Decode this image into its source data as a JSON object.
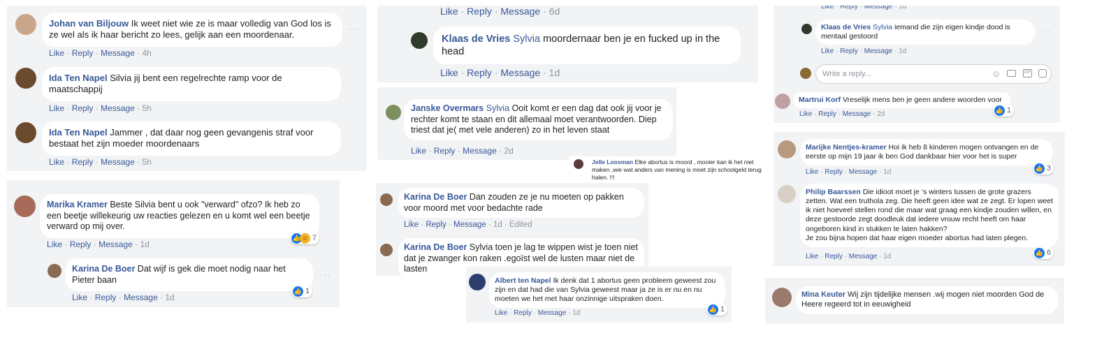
{
  "actions": {
    "like": "Like",
    "reply": "Reply",
    "message": "Message",
    "sep": "·",
    "edited": "Edited"
  },
  "p1": {
    "c1": {
      "name": "Johan van Biljouw",
      "text": "Ik weet niet wie ze is maar volledig van God los is ze wel als ik haar bericht zo lees, gelijk aan een moordenaar.",
      "time": "4h"
    },
    "c2": {
      "name": "Ida Ten Napel",
      "text": "Silvia jij bent een regelrechte ramp voor de maatschappij",
      "time": "5h"
    },
    "c3": {
      "name": "Ida Ten Napel",
      "text": "Jammer , dat daar nog geen gevangenis straf voor bestaat het zijn moeder moordenaars",
      "time": "5h"
    }
  },
  "p2": {
    "c1": {
      "name": "Marika Kramer",
      "text": "Beste Silvia bent u ook \"verward\" ofzo? Ik heb zo een beetje willekeurig uw reacties gelezen en u komt wel een beetje verward op mij over.",
      "time": "1d",
      "reactions": "7"
    },
    "c2": {
      "name": "Karina De Boer",
      "text": "Dat wijf is gek die moet nodig naar het Pieter baan",
      "time": "1d",
      "reactions": "1"
    }
  },
  "p3": {
    "top_time": "6d",
    "c1": {
      "name": "Klaas de Vries",
      "mention": "Sylvia",
      "text": "moordernaar ben je en fucked up in the head",
      "time": "1d"
    }
  },
  "p4": {
    "c1": {
      "name": "Janske Overmars",
      "mention": "Sylvia",
      "text": "Ooit komt er een dag dat ook jij voor je rechter komt te staan en dit allemaal moet verantwoorden. Diep triest dat je( met vele anderen) zo in het leven staat",
      "time": "2d"
    }
  },
  "p5": {
    "c1": {
      "name": "Jelle Loosman",
      "text": "Elke abortus is moord , mooier kan ik het niet maken ,wie wat anders van mening is moet zijn schoolgeld terug halen. !!!"
    }
  },
  "p6": {
    "c1": {
      "name": "Karina De Boer",
      "text": "Dan zouden ze je nu moeten op pakken voor moord met voor bedachte rade",
      "time": "1d"
    },
    "c2": {
      "name": "Karina De Boer",
      "text": "Sylvia toen je lag te wippen wist je toen niet dat je zwanger kon raken .egoïst wel de lusten maar niet de lasten"
    }
  },
  "p7": {
    "c1": {
      "name": "Albert ten Napel",
      "text": "Ik denk dat 1 abortus geen probleem geweest zou zijn en dat had die van Sylvia geweest maar ja ze is er nu en nu moeten we het met haar onzinnige uitspraken doen.",
      "time": "1d",
      "reactions": "1"
    }
  },
  "p8": {
    "top_time": "1d",
    "c1": {
      "name": "Klaas de Vries",
      "mention": "Sylvia",
      "text": "iemand die zijn eigen kindje dood is mentaal gestoord",
      "time": "1d"
    },
    "reply_placeholder": "Write a reply...",
    "c2": {
      "name": "Martrui Korf",
      "text": "Vreselijk mens ben je geen andere woorden voor",
      "time": "2d",
      "reactions": "1"
    }
  },
  "p9": {
    "c1": {
      "name": "Marijke Nentjes-kramer",
      "text": "Hoi ik heb 8 kinderen mogen ontvangen en de eerste op mijn 19 jaar ik ben God dankbaar hier voor het is super",
      "reactions": "3"
    },
    "c2": {
      "name": "Philip Baarssen",
      "text": "Die idioot moet je ‘s winters tussen de grote grazers zetten. Wat een truthola zeg. Die heeft geen idee wat ze zegt. Er lopen weet ik niet hoeveel stellen rond die maar wat graag een kindje zouden willen, en deze gestoorde zegt doodleuk dat iedere vrouw recht heeft om haar ongeboren kind in stukken te laten hakken?",
      "text2": "Je zou bijna hopen dat haar eigen moeder abortus had laten plegen.",
      "time": "1d",
      "reactions": "6"
    }
  },
  "p10": {
    "c1": {
      "name": "Mina Keuter",
      "text": "Wij zijn tijdelijke mensen .wij mogen niet moorden God de Heere regeerd tot in eeuwigheid",
      "time": "1d"
    }
  }
}
